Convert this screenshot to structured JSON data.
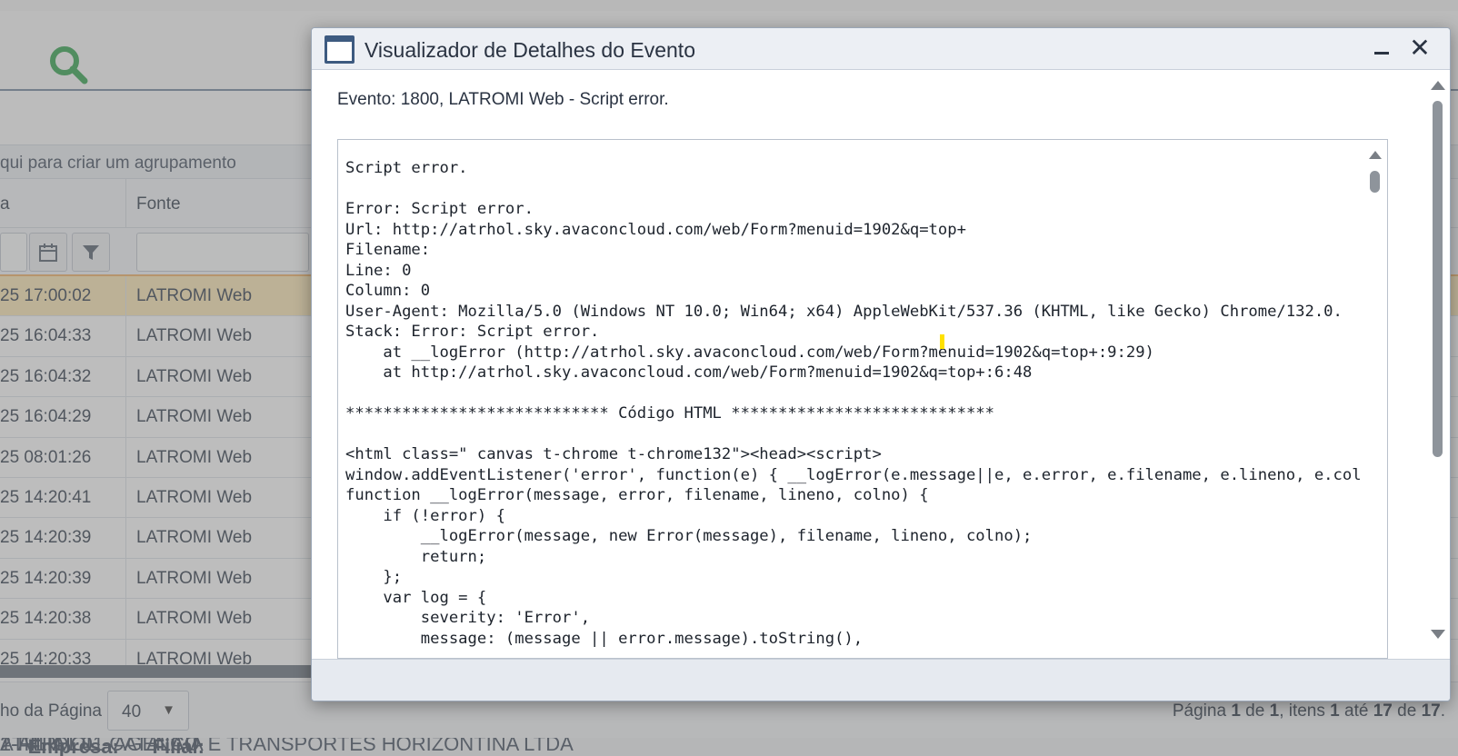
{
  "background": {
    "group_hint": "qui para criar um agrupamento",
    "columns": [
      "a",
      "Fonte"
    ],
    "rows": [
      {
        "date": "25 17:00:02",
        "source": "LATROMI Web",
        "selected": true
      },
      {
        "date": "25 16:04:33",
        "source": "LATROMI Web"
      },
      {
        "date": "25 16:04:32",
        "source": "LATROMI Web"
      },
      {
        "date": "25 16:04:29",
        "source": "LATROMI Web"
      },
      {
        "date": "25 08:01:26",
        "source": "LATROMI Web"
      },
      {
        "date": "25 14:20:41",
        "source": "LATROMI Web"
      },
      {
        "date": "25 14:20:39",
        "source": "LATROMI Web"
      },
      {
        "date": "25 14:20:39",
        "source": "LATROMI Web"
      },
      {
        "date": "25 14:20:38",
        "source": "LATROMI Web"
      },
      {
        "date": "25 14:20:33",
        "source": "LATROMI Web"
      }
    ],
    "footer": {
      "page_size_label": "ho da Página",
      "page_size_value": "40",
      "paging_prefix": "Página ",
      "page": "1",
      "of_word": " de ",
      "total_pages": "1",
      "items_word": ", itens ",
      "from": "1",
      "to_word": " até ",
      "to": "17",
      "of_word2": " de ",
      "total": "17",
      "suffix": "."
    },
    "status": {
      "prefix": "ATRHOL",
      "empresa_label": "Empresa:",
      "empresa_value": "1-ATRHOL - AGENCIA E TRANSPORTES HORIZONTINA LTDA",
      "filial_label": "Filial:",
      "filial_value": "2-FILIAL 01 CATALÃO"
    }
  },
  "dialog": {
    "title": "Visualizador de Detalhes do Evento",
    "event_line": "Evento: 1800, LATROMI Web - Script error.",
    "code_lines": [
      "Script error.",
      "",
      "Error: Script error.",
      "Url: http://atrhol.sky.avaconcloud.com/web/Form?menuid=1902&q=top+",
      "Filename:",
      "Line: 0",
      "Column: 0",
      "User-Agent: Mozilla/5.0 (Windows NT 10.0; Win64; x64) AppleWebKit/537.36 (KHTML, like Gecko) Chrome/132.0.",
      "Stack: Error: Script error.",
      "    at __logError (http://atrhol.sky.avaconcloud.com/web/Form?menuid=1902&q=top+:9:29)",
      "    at http://atrhol.sky.avaconcloud.com/web/Form?menuid=1902&q=top+:6:48",
      "",
      "**************************** Código HTML ****************************",
      "",
      "<html class=\" canvas t-chrome t-chrome132\"><head><script>",
      "window.addEventListener('error', function(e) { __logError(e.message||e, e.error, e.filename, e.lineno, e.colno); });",
      "function __logError(message, error, filename, lineno, colno) {",
      "    if (!error) {",
      "        __logError(message, new Error(message), filename, lineno, colno);",
      "        return;",
      "    };",
      "    var log = {",
      "        severity: 'Error',",
      "        message: (message || error.message).toString(),"
    ]
  },
  "colors": {
    "accent": "#3d5a80",
    "search_icon": "#3aa655",
    "selected_row": "#fbe7b7"
  }
}
